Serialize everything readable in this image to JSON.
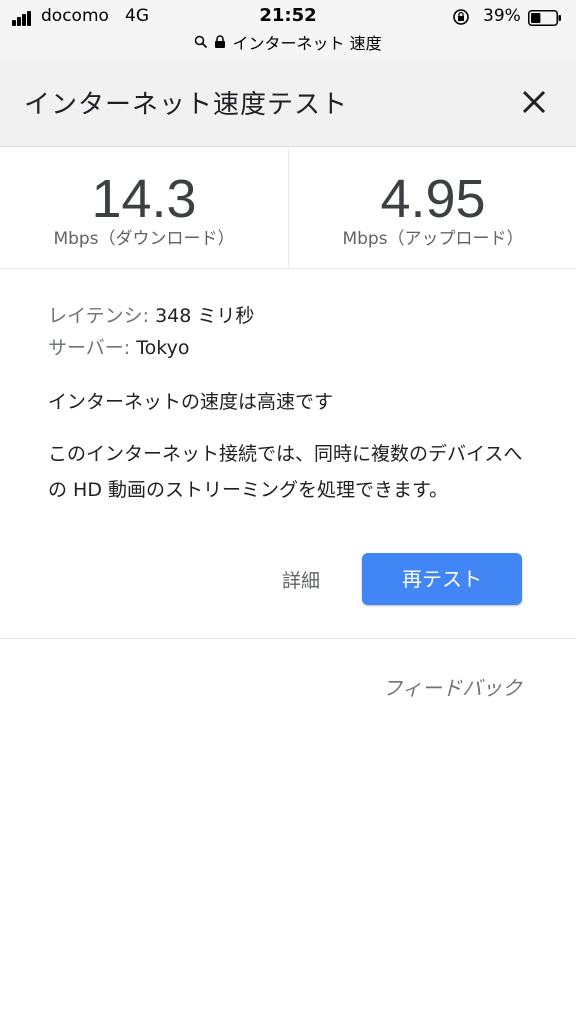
{
  "status_bar": {
    "carrier": "docomo",
    "network": "4G",
    "time": "21:52",
    "battery_percent": "39%",
    "battery_level": 0.39,
    "url_text": "インターネット 速度"
  },
  "header": {
    "title": "インターネット速度テスト",
    "close_icon": "close-icon"
  },
  "speed": {
    "download": {
      "value": "14.3",
      "unit": "Mbps（ダウンロード）"
    },
    "upload": {
      "value": "4.95",
      "unit": "Mbps（アップロード）"
    }
  },
  "info": {
    "latency_label": "レイテンシ:",
    "latency_value": "348 ミリ秒",
    "server_label": "サーバー:",
    "server_value": "Tokyo"
  },
  "summary": "インターネットの速度は高速です",
  "description": "このインターネット接続では、同時に複数のデバイスへの HD 動画のストリーミングを処理できます。",
  "actions": {
    "details_label": "詳細",
    "retest_label": "再テスト"
  },
  "feedback_label": "フィードバック",
  "colors": {
    "accent": "#4285f4",
    "header_bg": "#f1f1f1"
  }
}
